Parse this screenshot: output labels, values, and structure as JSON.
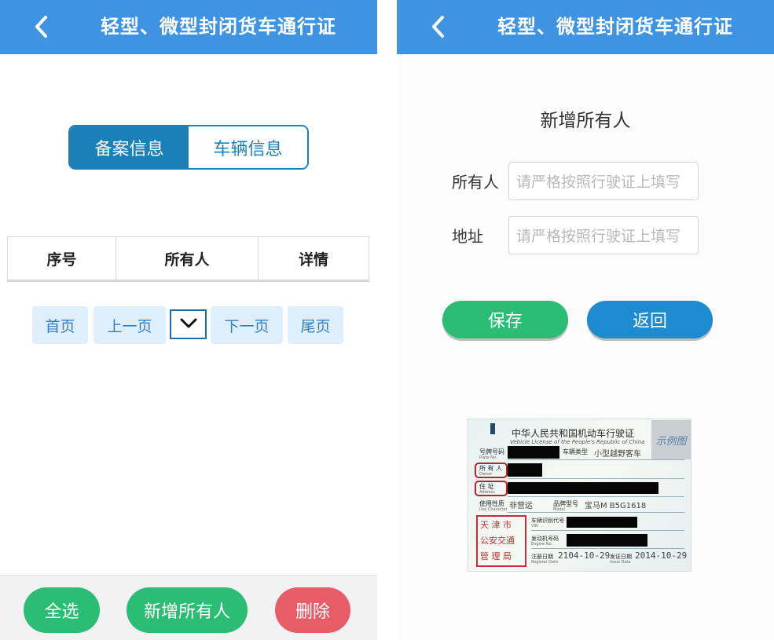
{
  "left": {
    "header": {
      "title": "轻型、微型封闭货车通行证"
    },
    "tabs": [
      {
        "label": "备案信息",
        "active": true
      },
      {
        "label": "车辆信息",
        "active": false
      }
    ],
    "table": {
      "columns": [
        "序号",
        "所有人",
        "详情"
      ]
    },
    "pagination": {
      "first": "首页",
      "prev": "上一页",
      "next": "下一页",
      "last": "尾页"
    },
    "actions": {
      "select_all": "全选",
      "add_owner": "新增所有人",
      "delete": "删除"
    }
  },
  "right": {
    "header": {
      "title": "轻型、微型封闭货车通行证"
    },
    "form": {
      "title": "新增所有人",
      "owner_label": "所有人",
      "owner_placeholder": "请严格按照行驶证上填写",
      "address_label": "地址",
      "address_placeholder": "请严格按照行驶证上填写",
      "save": "保存",
      "back": "返回"
    },
    "license": {
      "title_cn": "中华人民共和国机动车行驶证",
      "title_en": "Vehicle License of the People's Republic of China",
      "sample": "示例图",
      "plate_label": "号牌号码",
      "plate_label_en": "Plate No.",
      "vehicle_type_label": "车辆类型",
      "vehicle_type": "小型越野客车",
      "owner_label": "所 有 人",
      "owner_label_en": "Owner",
      "address_label": "住   址",
      "address_label_en": "Address",
      "use_label": "使用性质",
      "use_label_en": "Use Character",
      "use_value": "非营运",
      "model_label": "品牌型号",
      "model_label_en": "Model",
      "model_value": "宝马M B5G1618",
      "vin_label": "车辆识别代号",
      "vin_label_en": "VIN",
      "engine_label": "发动机号码",
      "engine_label_en": "Engine No.",
      "register_label": "注册日期",
      "register_label_en": "Register Date",
      "register_date": "2104-10-29",
      "issue_label": "发证日期",
      "issue_label_en": "Issue Date",
      "issue_date": "2014-10-29",
      "stamp_lines": [
        "天 津 市",
        "公安交通",
        "管 理 局"
      ]
    }
  },
  "colors": {
    "header": "#3f93e3",
    "tab_active": "#1b7fb8",
    "pagination_bg": "#dfeefc",
    "pagination_text": "#2f7fc6",
    "green": "#2bbd73",
    "red": "#e85c68",
    "blue_button": "#1d8bd0",
    "stamp": "#c23030"
  },
  "icons": [
    "back-arrow-icon",
    "chevron-down-icon"
  ]
}
